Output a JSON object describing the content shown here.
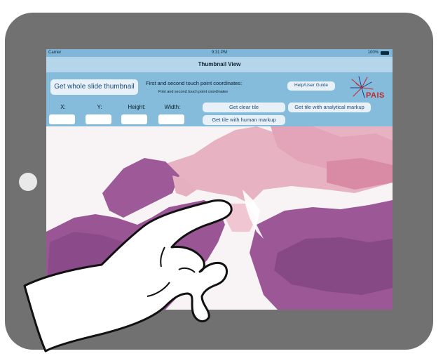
{
  "status_bar": {
    "carrier": "Carrier",
    "time": "9:31 PM",
    "battery": "100%"
  },
  "nav": {
    "title": "Thumbnail View"
  },
  "controls": {
    "whole_slide_button": "Get whole slide thumbnail",
    "coords_label": "First and second touch point coordinates:",
    "coords_value": "First and second touch point coordinates",
    "help_button": "Help/User Guide",
    "fields": [
      {
        "label": "X:"
      },
      {
        "label": "Y:"
      },
      {
        "label": "Height:"
      },
      {
        "label": "Width:"
      }
    ],
    "clear_tile_button": "Get clear tile",
    "analytical_button": "Get tile with analytical markup",
    "human_button": "Get tile with human markup"
  },
  "logo": {
    "text": "PAIS"
  },
  "colors": {
    "bezel": "#717171",
    "controls_bg": "#86bcdb",
    "navbar_bg": "#b5d6ea",
    "button_text": "#1d4a7a",
    "tissue_purple": "#9a5a94",
    "tissue_pink": "#e3a8b8"
  }
}
